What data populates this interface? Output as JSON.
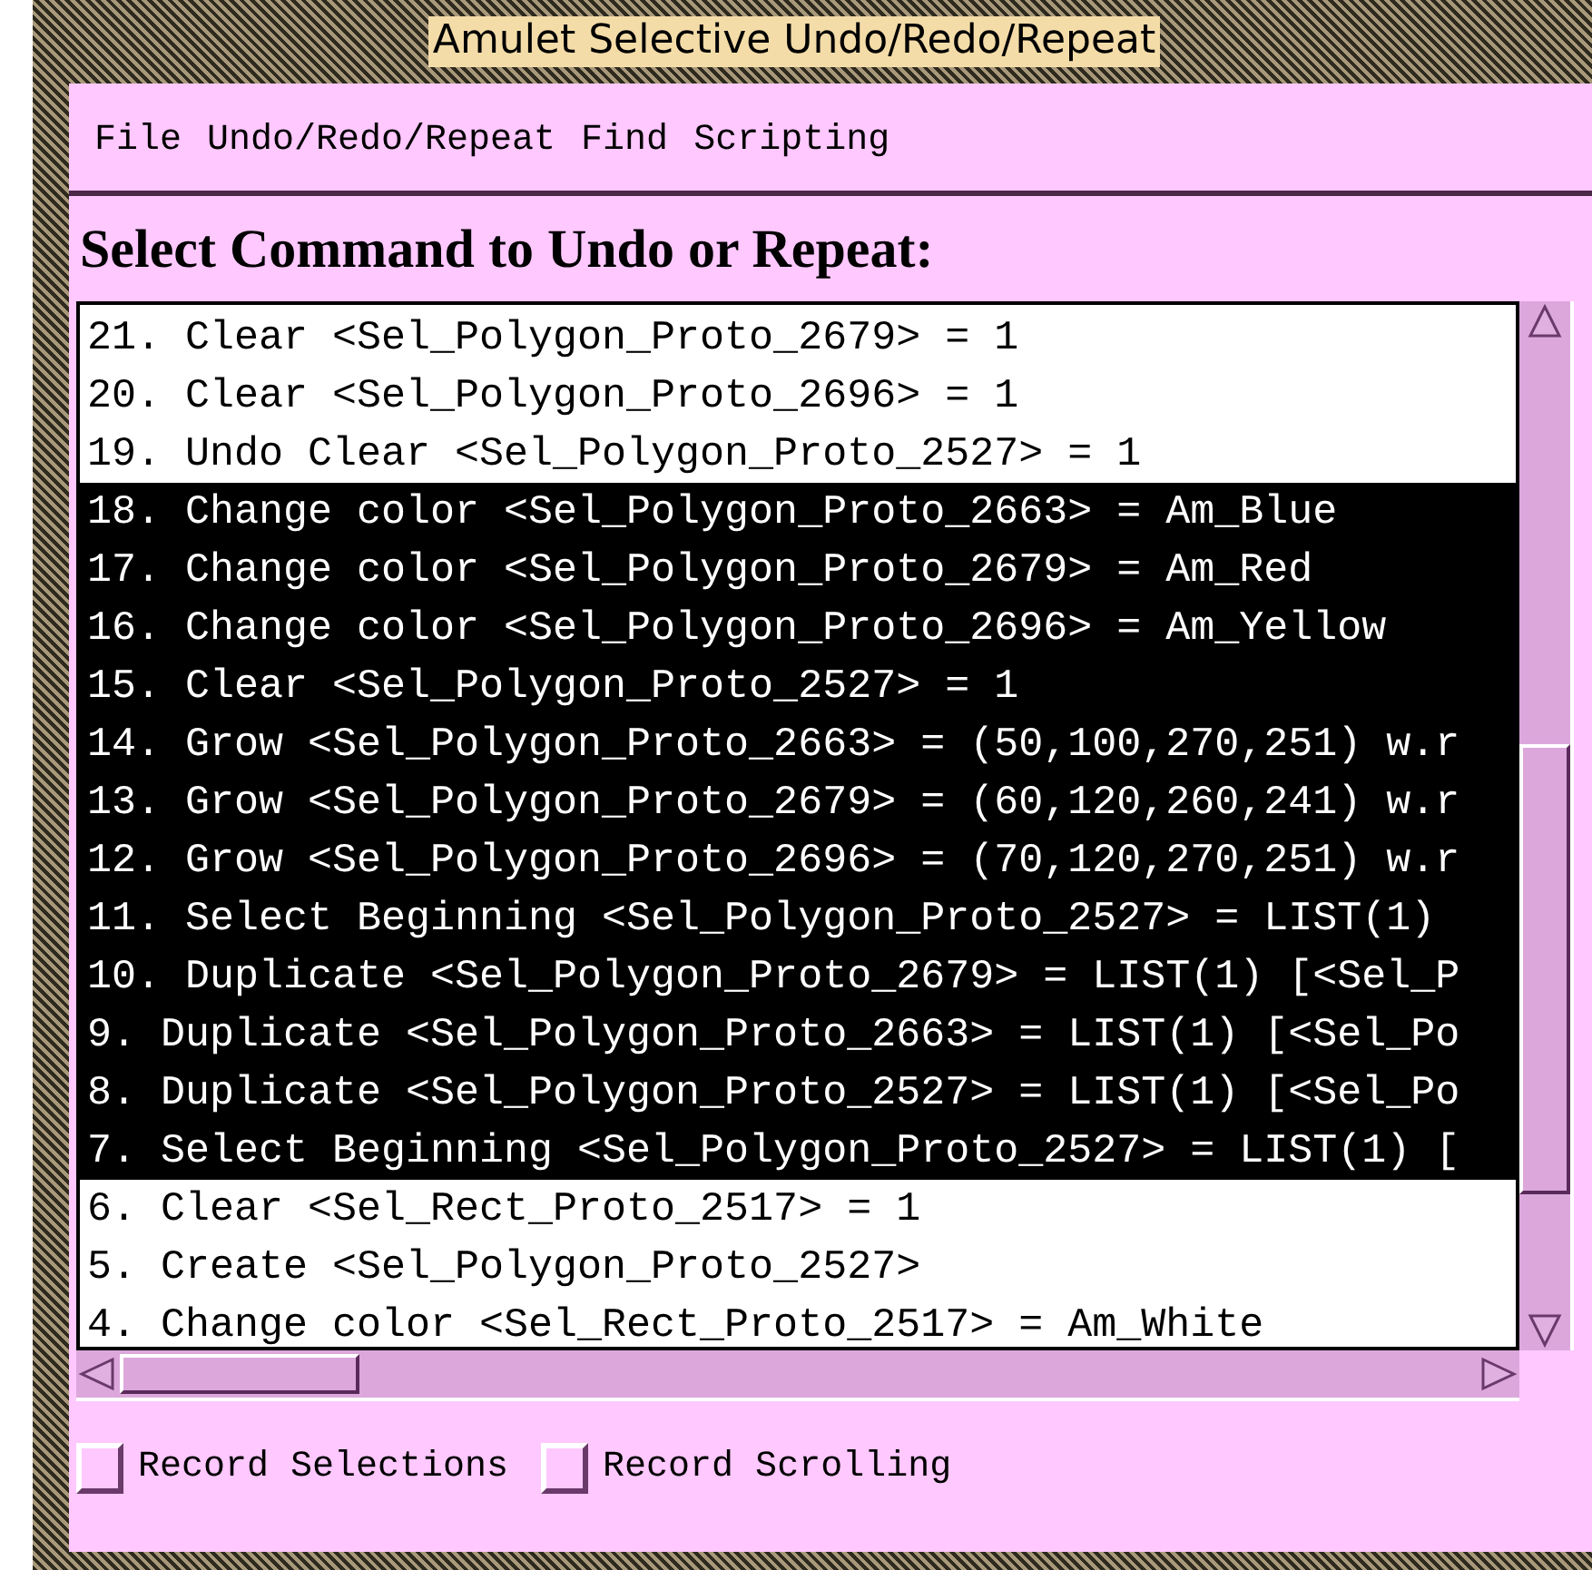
{
  "window": {
    "title": "Amulet Selective Undo/Redo/Repeat"
  },
  "menu": [
    "File",
    "Undo/Redo/Repeat",
    "Find",
    "Scripting"
  ],
  "heading": "Select Command to Undo or Repeat:",
  "commands": [
    {
      "text": "21. Clear <Sel_Polygon_Proto_2679> = 1",
      "selected": false
    },
    {
      "text": "20. Clear <Sel_Polygon_Proto_2696> = 1",
      "selected": false
    },
    {
      "text": "19. Undo Clear <Sel_Polygon_Proto_2527> = 1",
      "selected": false
    },
    {
      "text": "18. Change color <Sel_Polygon_Proto_2663> = Am_Blue",
      "selected": true
    },
    {
      "text": "17. Change color <Sel_Polygon_Proto_2679> = Am_Red",
      "selected": true
    },
    {
      "text": "16. Change color <Sel_Polygon_Proto_2696> = Am_Yellow",
      "selected": true
    },
    {
      "text": "15. Clear <Sel_Polygon_Proto_2527> = 1",
      "selected": true
    },
    {
      "text": "14. Grow <Sel_Polygon_Proto_2663> = (50,100,270,251) w.r",
      "selected": true
    },
    {
      "text": "13. Grow <Sel_Polygon_Proto_2679> = (60,120,260,241) w.r",
      "selected": true
    },
    {
      "text": "12. Grow <Sel_Polygon_Proto_2696> = (70,120,270,251) w.r",
      "selected": true
    },
    {
      "text": "11. Select Beginning <Sel_Polygon_Proto_2527> = LIST(1)",
      "selected": true
    },
    {
      "text": "10. Duplicate <Sel_Polygon_Proto_2679> = LIST(1) [<Sel_P",
      "selected": true
    },
    {
      "text": "9. Duplicate <Sel_Polygon_Proto_2663> = LIST(1) [<Sel_Po",
      "selected": true
    },
    {
      "text": "8. Duplicate <Sel_Polygon_Proto_2527> = LIST(1) [<Sel_Po",
      "selected": true
    },
    {
      "text": "7. Select Beginning <Sel_Polygon_Proto_2527> = LIST(1) [",
      "selected": true
    },
    {
      "text": "6. Clear <Sel_Rect_Proto_2517> = 1",
      "selected": false
    },
    {
      "text": "5. Create <Sel_Polygon_Proto_2527>",
      "selected": false
    },
    {
      "text": "4. Change color <Sel_Rect_Proto_2517> = Am_White",
      "selected": false
    }
  ],
  "options": [
    {
      "label": "Record Selections",
      "checked": false
    },
    {
      "label": "Record Scrolling",
      "checked": false
    }
  ]
}
